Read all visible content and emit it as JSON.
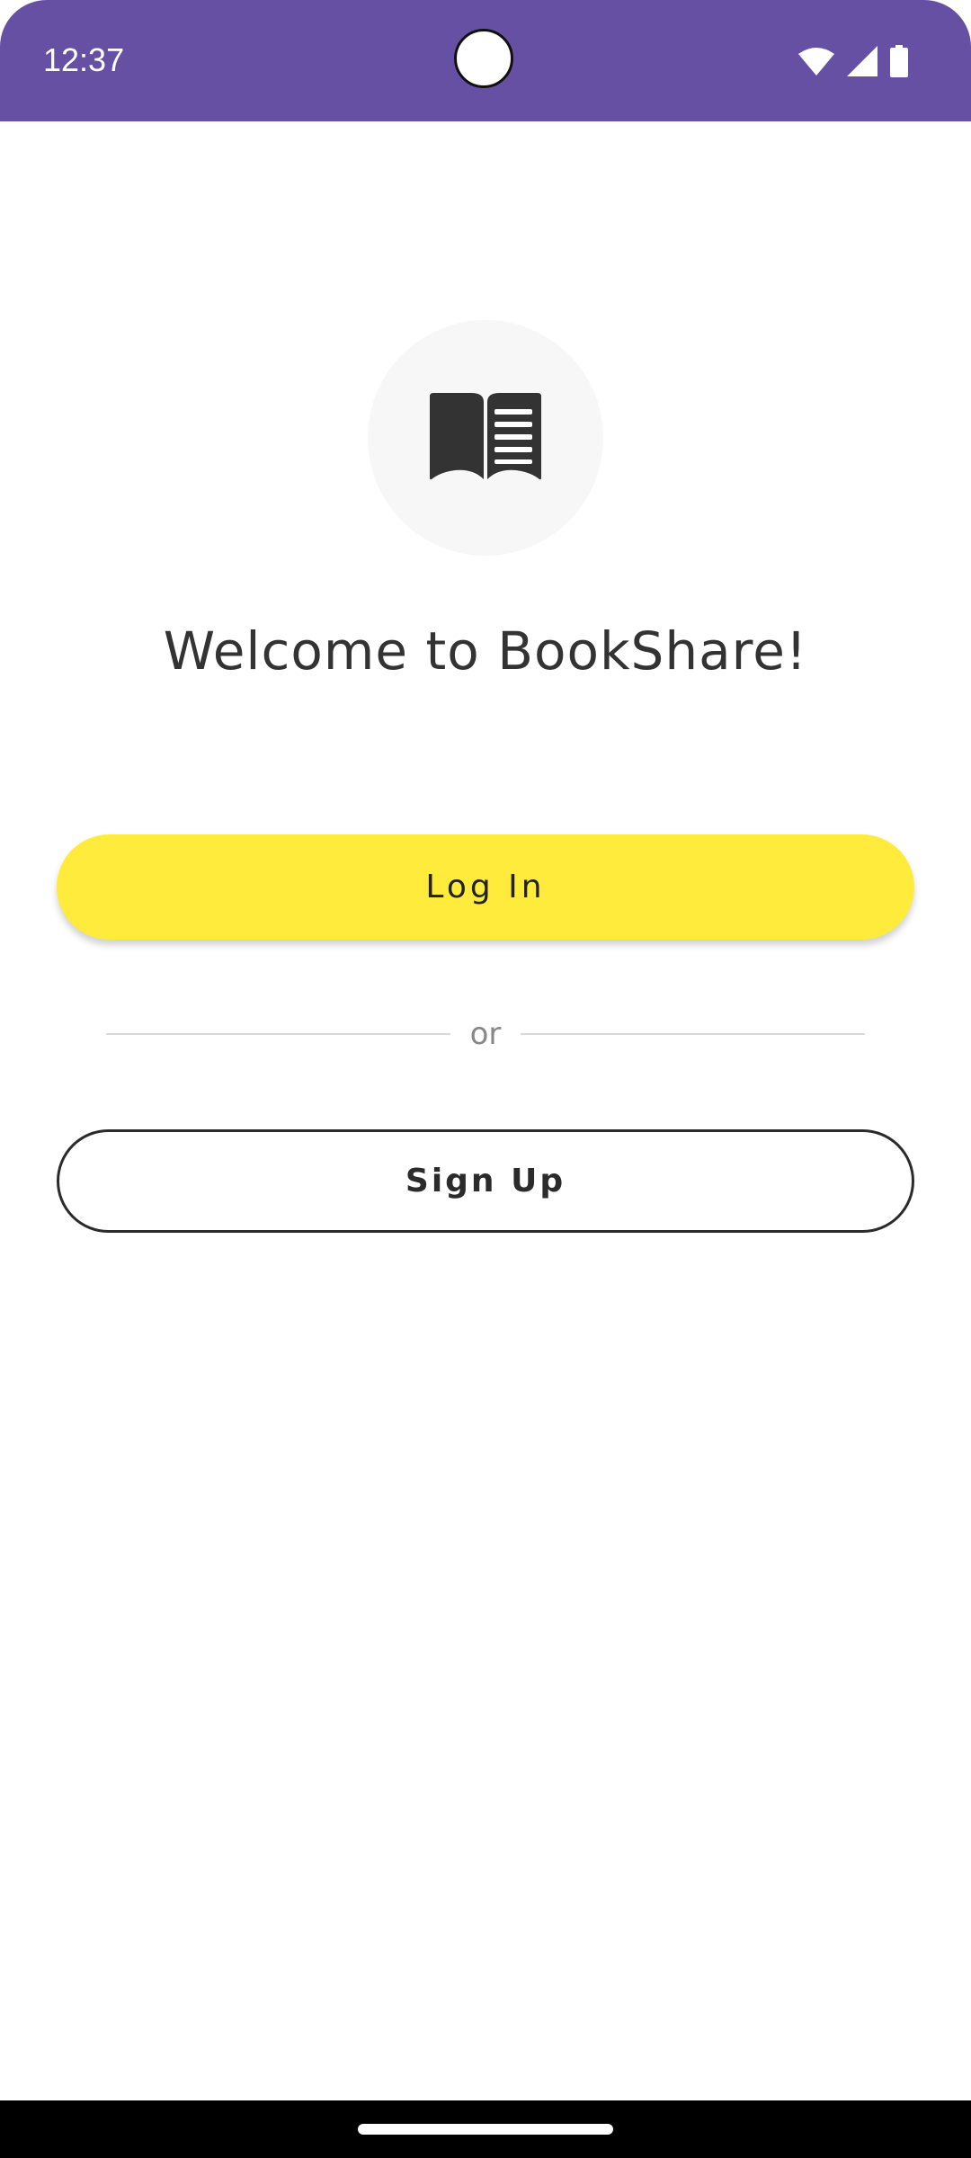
{
  "status_bar": {
    "time": "12:37",
    "icons": [
      "wifi-icon",
      "signal-icon",
      "battery-icon"
    ],
    "background_color": "#6650a4"
  },
  "logo": {
    "icon": "open-book-icon"
  },
  "welcome": {
    "title": "Welcome to BookShare!"
  },
  "login_button": {
    "label": "Log In",
    "color": "#ffeb3b"
  },
  "divider": {
    "text": "or"
  },
  "signup_button": {
    "label": "Sign Up"
  }
}
